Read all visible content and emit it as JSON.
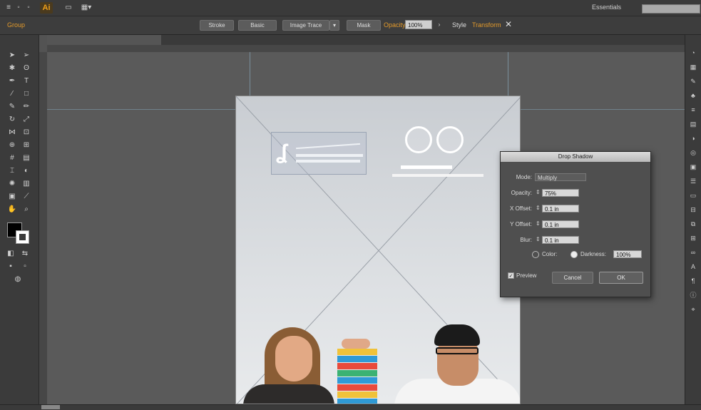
{
  "menubar": {
    "app_logo": "Ai",
    "icons": [
      "bridge-icon",
      "stock-icon",
      "arrange-documents-icon"
    ],
    "workspace_label": "Essentials",
    "search_placeholder": ""
  },
  "controlbar": {
    "selection_label": "Group",
    "stroke_label": "",
    "opacity_label": "Opacity",
    "opacity_value": "100%",
    "style_label": "Style",
    "buttons": [
      "Stroke",
      "Basic",
      "Image Trace",
      "Mask",
      "Opacity"
    ],
    "transform_label": "Transform"
  },
  "document": {
    "tab_title": "",
    "tab_secondary": ""
  },
  "colors": {
    "accent_orange": "#e39a2b",
    "panel_dark": "#3b3b3b",
    "canvas_gray": "#5a5a5a",
    "guide_blue": "#8fb3c8"
  },
  "dialog": {
    "title": "Drop Shadow",
    "mode_label": "Mode:",
    "mode_value": "Multiply",
    "opacity_label": "Opacity:",
    "opacity_value": "75%",
    "xoffset_label": "X Offset:",
    "xoffset_value": "0.1 in",
    "yoffset_label": "Y Offset:",
    "yoffset_value": "0.1 in",
    "blur_label": "Blur:",
    "blur_value": "0.1 in",
    "color_label": "Color:",
    "darkness_label": "Darkness:",
    "darkness_value": "100%",
    "preview_label": "Preview",
    "cancel_label": "Cancel",
    "ok_label": "OK"
  }
}
